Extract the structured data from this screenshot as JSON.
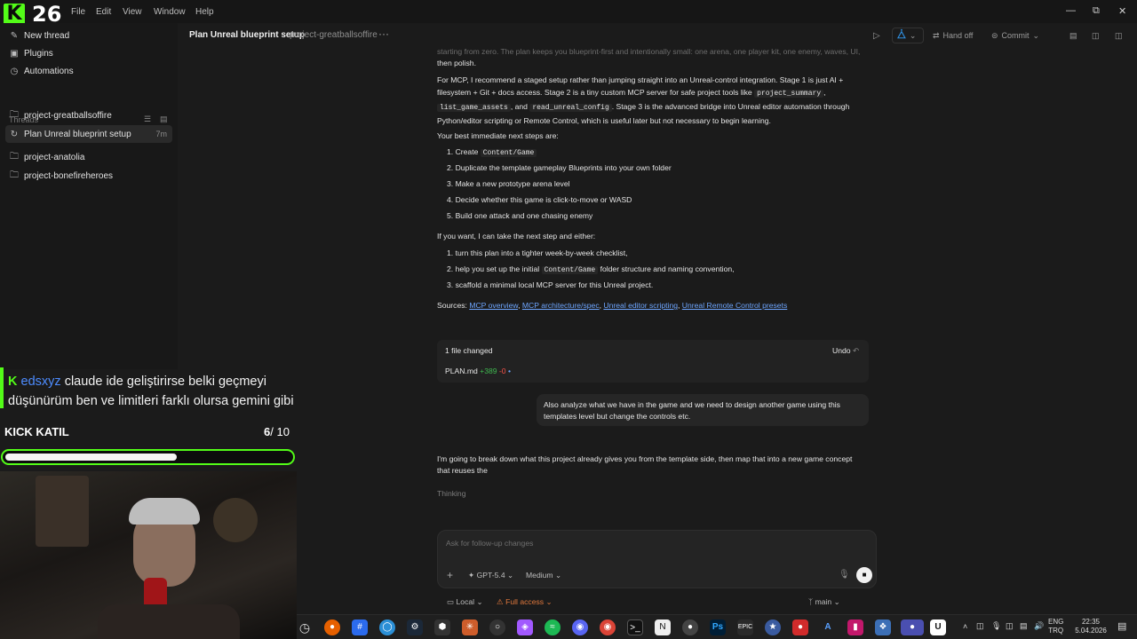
{
  "app": {
    "kick_count": "26",
    "menu": [
      "File",
      "Edit",
      "View",
      "Window",
      "Help"
    ]
  },
  "sidebar": {
    "top_items": [
      {
        "label": "New thread",
        "icon": "edit-icon"
      },
      {
        "label": "Plugins",
        "icon": "plugin-icon"
      },
      {
        "label": "Automations",
        "icon": "clock-icon"
      }
    ],
    "threads_heading": "Threads",
    "threads": [
      {
        "label": "project-greatballsoffire",
        "icon": "folder-icon"
      },
      {
        "label": "Plan Unreal blueprint setup",
        "time": "7m",
        "active": true,
        "icon": "spinner-icon"
      },
      {
        "label": "project-anatolia",
        "icon": "folder-icon"
      },
      {
        "label": "project-bonefireheroes",
        "icon": "folder-icon"
      }
    ]
  },
  "header": {
    "title": "Plan Unreal blueprint setup",
    "project": "project-greatballsoffire",
    "more": "···",
    "handoff": "Hand off",
    "commit": "Commit"
  },
  "conversation": {
    "faded_intro": "starting from zero. The plan keeps you blueprint-first and intentionally small: one arena, one player kit, one enemy, waves, UI,",
    "intro_tail": "then polish.",
    "mcp_para": {
      "part1": "For MCP, I recommend a staged setup rather than jumping straight into an Unreal-control integration. Stage 1 is just AI + filesystem + Git + docs access. Stage 2 is a tiny custom MCP server for safe project tools like",
      "code1": "project_summary",
      "sep1": ",",
      "code2": "list_game_assets",
      "sep2": ", and",
      "code3": "read_unreal_config",
      "part2": ". Stage 3 is the advanced bridge into Unreal editor automation through Python/editor scripting or Remote Control, which is useful later but not necessary to begin learning."
    },
    "next_steps_heading": "Your best immediate next steps are:",
    "next_steps": [
      {
        "n": "1.",
        "text": "Create",
        "code": "Content/Game"
      },
      {
        "n": "2.",
        "text": "Duplicate the template gameplay Blueprints into your own folder"
      },
      {
        "n": "3.",
        "text": "Make a new prototype arena level"
      },
      {
        "n": "4.",
        "text": "Decide whether this game is click-to-move or WASD"
      },
      {
        "n": "5.",
        "text": "Build one attack and one chasing enemy"
      }
    ],
    "offer_heading": "If you want, I can take the next step and either:",
    "offers": [
      {
        "n": "1.",
        "text": "turn this plan into a tighter week-by-week checklist,"
      },
      {
        "n": "2.",
        "text": "help you set up the initial",
        "code": "Content/Game",
        "tail": "folder structure and naming convention,"
      },
      {
        "n": "3.",
        "text": "scaffold a minimal local MCP server for this Unreal project."
      }
    ],
    "sources_label": "Sources:",
    "sources": [
      "MCP overview",
      "MCP architecture/spec",
      "Unreal editor scripting",
      "Unreal Remote Control presets"
    ],
    "files_changed": "1 file changed",
    "undo": "Undo",
    "file": {
      "name": "PLAN.md",
      "added": "+389",
      "removed": "-0"
    },
    "user_message": "Also analyze what we have in the game and we need to design another game using this templates level but change the controls etc.",
    "assistant_reply": "I'm going to break down what this project already gives you from the template side, then map that into a new game concept that reuses the",
    "thinking": "Thinking"
  },
  "composer": {
    "placeholder": "Ask for follow-up changes",
    "model": "GPT-5.4",
    "effort": "Medium",
    "env": "Local",
    "access": "Full access",
    "branch": "main"
  },
  "stream": {
    "chat_user": "edsxyz",
    "chat_message": "claude ide geliştirirse belki geçmeyi düşünürüm ben ve limitleri farklı olursa gemini gibi",
    "goal_label": "KICK KATIL",
    "goal_current": "6",
    "goal_total": "/ 10",
    "goal_progress": 0.6
  },
  "taskbar": {
    "lang": "ENG",
    "region": "TRQ",
    "time": "22:35",
    "date": "5.04.2026"
  },
  "colors": {
    "kick_green": "#53fc18",
    "link": "#6ea6ff",
    "added": "#3fb950",
    "removed": "#f85149",
    "full_access": "#e0783c"
  }
}
